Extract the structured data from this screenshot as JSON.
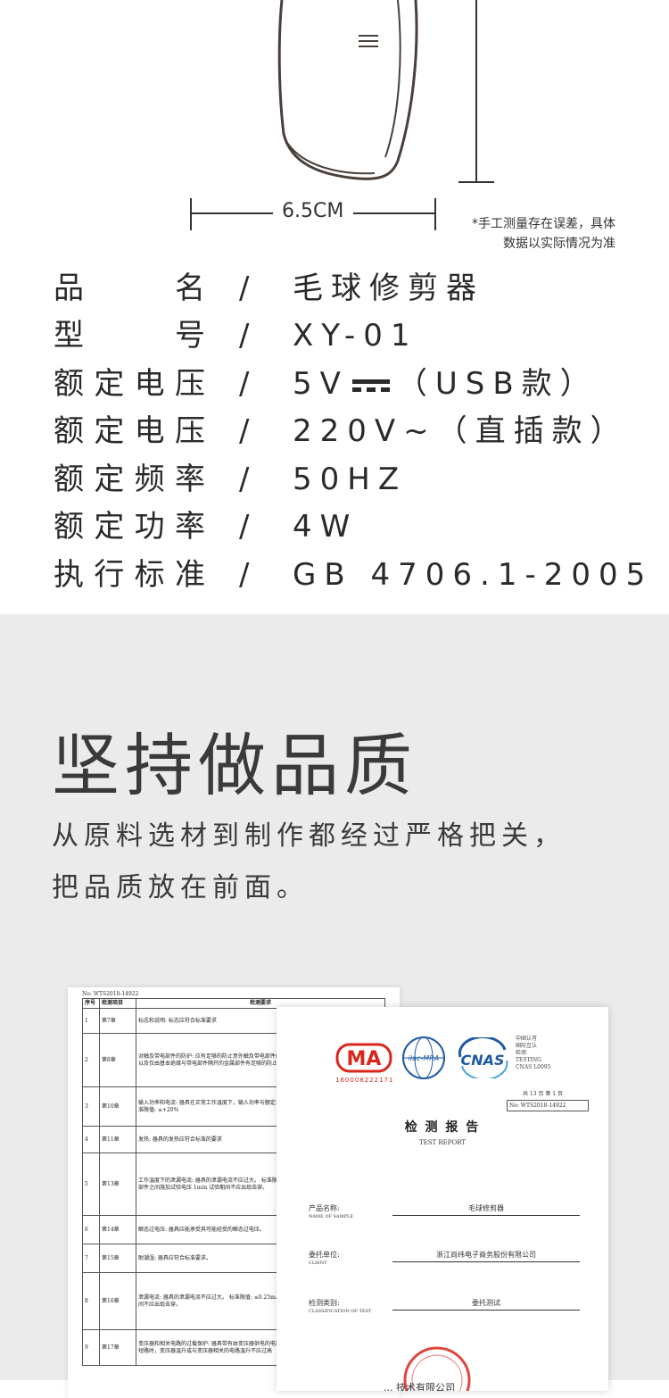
{
  "product_image": {
    "width_dimension": "6.5CM",
    "measure_note_line1": "*手工测量存在误差，具体",
    "measure_note_line2": "数据以实际情况为准"
  },
  "specs": [
    {
      "label": [
        "品",
        "名"
      ],
      "slash": "/",
      "value": "毛球修剪器"
    },
    {
      "label": [
        "型",
        "号"
      ],
      "slash": "/",
      "value": "XY-01"
    },
    {
      "label": [
        "额",
        "定",
        "电",
        "压"
      ],
      "slash": "/",
      "value_pre": "5V",
      "value_post": "（USB款）"
    },
    {
      "label": [
        "额",
        "定",
        "电",
        "压"
      ],
      "slash": "/",
      "value": "220V~（直插款）"
    },
    {
      "label": [
        "额",
        "定",
        "频",
        "率"
      ],
      "slash": "/",
      "value": "50HZ"
    },
    {
      "label": [
        "额",
        "定",
        "功",
        "率"
      ],
      "slash": "/",
      "value": "4W"
    },
    {
      "label": [
        "执",
        "行",
        "标",
        "准"
      ],
      "slash": "/",
      "value": "GB 4706.1-2005"
    }
  ],
  "quality": {
    "headline": "坚持做品质",
    "line1": "从原料选材到制作都经过严格把关，",
    "line2": "把品质放在前面。"
  },
  "cert_back": {
    "report_no": "No: WTS2018-14922",
    "col_no": "序号",
    "col_item": "检测项目",
    "col_req": "检测要求",
    "rows": [
      {
        "no": "1",
        "chapter": "第7章",
        "req": "标志和说明: 标志应符合标准要求"
      },
      {
        "no": "2",
        "chapter": "第8章",
        "req": "对触及带电部件的防护: 应有足够的防止意外触及带电部件的防护 II类器具和III类结构，应对基本绝缘以及仅由基本绝缘与带电部件隔开的金属部件有足够的防止意外接触的保护"
      },
      {
        "no": "3",
        "chapter": "第10章",
        "req": "输入功率和电流: 器具在正常工作温度下，输入功率与额定功率的偏差不应超过标准的规定的范围。 标准限值: ≤+20%"
      },
      {
        "no": "4",
        "chapter": "第11章",
        "req": "发热: 器具的发热应符合标准的要求"
      },
      {
        "no": "5",
        "chapter": "第13章",
        "req": "工作温度下的泄漏电流: 器具的泄漏电流不应过大。 标准限值: ≤0.25mA 电气强度: 带电部件与易触及部件之间施加试验电压 1min 试验期间不应出现击穿。"
      },
      {
        "no": "6",
        "chapter": "第14章",
        "req": "瞬态过电压: 器具应能承受其可能经受的瞬态过电压。"
      },
      {
        "no": "7",
        "chapter": "第15章",
        "req": "耐潮湿: 器具应符合标准要求。"
      },
      {
        "no": "8",
        "chapter": "第16章",
        "req": "泄漏电流: 器具的泄漏电流不应过大。 标准限值: ≤0.25mA 电气强度: 器具的电气强度试验，在试验期间不应出现击穿。"
      },
      {
        "no": "9",
        "chapter": "第17章",
        "req": "变压器和相关电路的过载保护: 器具带有由变压器供电的电路时，其结构应使得在正常使用中可能出现的短路时，变压器温升或与变压器相关的电路温升不应过高"
      }
    ]
  },
  "cert_front": {
    "ma_text": "MA",
    "ma_number": "160008222171",
    "ilac_text": "ilac-MRA",
    "cnas_text": "CNAS",
    "accred_cn1": "中国认可",
    "accred_cn2": "国际互认",
    "accred_cn3": "检测",
    "accred_en1": "TESTING",
    "accred_en2": "CNAS L0095",
    "page_info": "共 13 页  第 1 页",
    "report_no": "No: WTS2018-14922",
    "title_cn": "检 测 报 告",
    "title_en": "TEST REPORT",
    "f1_label": "产品名称:",
    "f1_sub": "NAME OF SAMPLE",
    "f1_value": "毛球修剪器",
    "f2_label": "委托单位:",
    "f2_sub": "CLIENT",
    "f2_value": "浙江尚纬电子商务股份有限公司",
    "f3_label": "检测类别:",
    "f3_sub": "CLASSIFICATION OF TEST",
    "f3_value": "委托测试",
    "bottom_text": "... 技术有限公司"
  },
  "colors": {
    "bg_gray": "#ebebeb",
    "text": "#2a2a2a",
    "ma_red": "#d9261c",
    "cnas_blue": "#1f5aa6",
    "stamp_red": "#d9261c"
  }
}
